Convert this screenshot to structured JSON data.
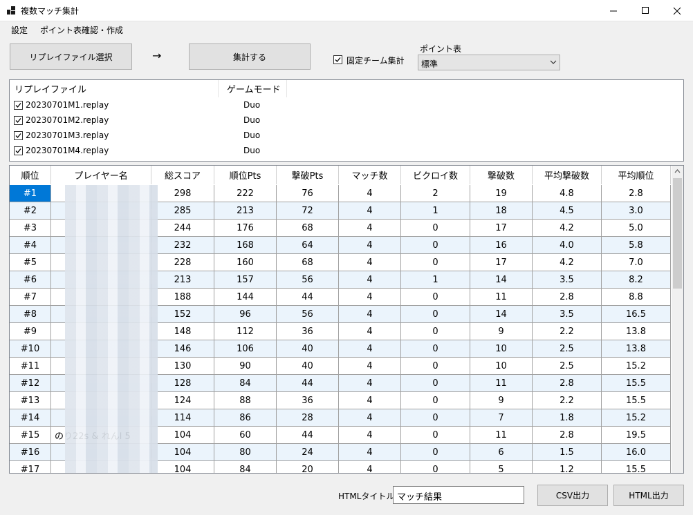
{
  "window": {
    "title": "複数マッチ集計",
    "minimize_glyph": "—",
    "maximize_glyph": "☐",
    "close_glyph": "✕"
  },
  "menu": [
    "設定",
    "ポイント表確認・作成"
  ],
  "toolbar": {
    "select_replay_label": "リプレイファイル選択",
    "arrow": "→",
    "aggregate_label": "集計する",
    "fixed_team_label": "固定チーム集計",
    "fixed_team_checked": true,
    "points_table_label": "ポイント表",
    "points_table_value": "標準"
  },
  "replay_list": {
    "headers": [
      "リプレイファイル",
      "ゲームモード"
    ],
    "rows": [
      {
        "file": "20230701M1.replay",
        "mode": "Duo",
        "checked": true
      },
      {
        "file": "20230701M2.replay",
        "mode": "Duo",
        "checked": true
      },
      {
        "file": "20230701M3.replay",
        "mode": "Duo",
        "checked": true
      },
      {
        "file": "20230701M4.replay",
        "mode": "Duo",
        "checked": true
      }
    ]
  },
  "results": {
    "headers": [
      "順位",
      "プレイヤー名",
      "総スコア",
      "順位Pts",
      "撃破Pts",
      "マッチ数",
      "ビクロイ数",
      "撃破数",
      "平均撃破数",
      "平均順位"
    ],
    "rows": [
      [
        "#1",
        "",
        "298",
        "222",
        "76",
        "4",
        "2",
        "19",
        "4.8",
        "2.8"
      ],
      [
        "#2",
        "",
        "285",
        "213",
        "72",
        "4",
        "1",
        "18",
        "4.5",
        "3.0"
      ],
      [
        "#3",
        "",
        "244",
        "176",
        "68",
        "4",
        "0",
        "17",
        "4.2",
        "5.0"
      ],
      [
        "#4",
        "",
        "232",
        "168",
        "64",
        "4",
        "0",
        "16",
        "4.0",
        "5.8"
      ],
      [
        "#5",
        "",
        "228",
        "160",
        "68",
        "4",
        "0",
        "17",
        "4.2",
        "7.0"
      ],
      [
        "#6",
        "",
        "213",
        "157",
        "56",
        "4",
        "1",
        "14",
        "3.5",
        "8.2"
      ],
      [
        "#7",
        "",
        "188",
        "144",
        "44",
        "4",
        "0",
        "11",
        "2.8",
        "8.8"
      ],
      [
        "#8",
        "",
        "152",
        "96",
        "56",
        "4",
        "0",
        "14",
        "3.5",
        "16.5"
      ],
      [
        "#9",
        "",
        "148",
        "112",
        "36",
        "4",
        "0",
        "9",
        "2.2",
        "13.8"
      ],
      [
        "#10",
        "",
        "146",
        "106",
        "40",
        "4",
        "0",
        "10",
        "2.5",
        "13.8"
      ],
      [
        "#11",
        "",
        "130",
        "90",
        "40",
        "4",
        "0",
        "10",
        "2.5",
        "15.2"
      ],
      [
        "#12",
        "",
        "128",
        "84",
        "44",
        "4",
        "0",
        "11",
        "2.8",
        "15.5"
      ],
      [
        "#13",
        "",
        "124",
        "88",
        "36",
        "4",
        "0",
        "9",
        "2.2",
        "15.5"
      ],
      [
        "#14",
        "",
        "114",
        "86",
        "28",
        "4",
        "0",
        "7",
        "1.8",
        "15.2"
      ],
      [
        "#15",
        "のり22s & れんl 5",
        "104",
        "60",
        "44",
        "4",
        "0",
        "11",
        "2.8",
        "19.5"
      ],
      [
        "#16",
        "",
        "104",
        "80",
        "24",
        "4",
        "0",
        "6",
        "1.5",
        "16.0"
      ],
      [
        "#17",
        "",
        "104",
        "84",
        "20",
        "4",
        "0",
        "5",
        "1.2",
        "15.5"
      ]
    ]
  },
  "footer": {
    "html_title_label": "HTMLタイトル",
    "html_title_value": "マッチ結果",
    "csv_button": "CSV出力",
    "html_button": "HTML出力"
  },
  "colors": {
    "selection": "#0078d7",
    "alt_row": "#ebf4fc",
    "button_face": "#e1e1e1"
  }
}
